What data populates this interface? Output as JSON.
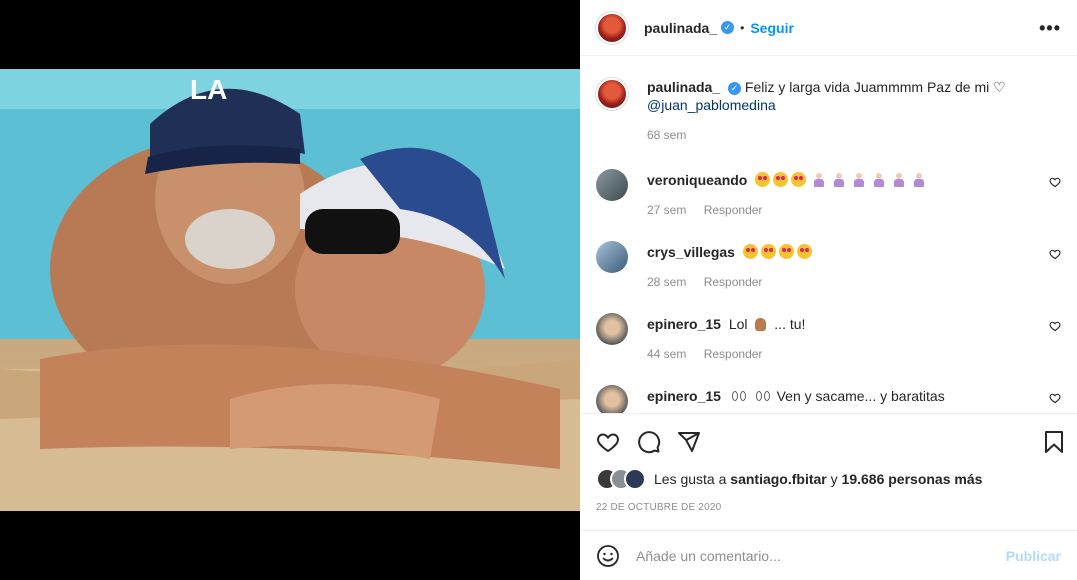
{
  "header": {
    "username": "paulinada_",
    "dot": "•",
    "follow_label": "Seguir",
    "more_label": "•••"
  },
  "caption": {
    "username": "paulinada_",
    "text": "Feliz y larga vida Juammmm Paz de mi ♡",
    "mention": "@juan_pablomedina",
    "time": "68 sem"
  },
  "comments": [
    {
      "username": "veroniqueando",
      "text": "",
      "emoji": "heart-eyes x3, person-bowing x6",
      "time": "27 sem",
      "reply_label": "Responder"
    },
    {
      "username": "crys_villegas",
      "text": "",
      "emoji": "heart-eyes x4",
      "time": "28 sem",
      "reply_label": "Responder"
    },
    {
      "username": "epinero_15",
      "text_before": "Lol",
      "text_after": "... tu!",
      "time": "44 sem",
      "reply_label": "Responder"
    },
    {
      "username": "epinero_15",
      "text": "Ven y sacame... y baratitas"
    }
  ],
  "likes": {
    "prefix": "Les gusta a",
    "user": "santiago.fbitar",
    "middle": "y",
    "count": "19.686 personas más"
  },
  "date": "22 DE OCTUBRE DE 2020",
  "add_comment": {
    "placeholder": "Añade un comentario...",
    "post_label": "Publicar"
  },
  "icons": {
    "like": "heart-icon",
    "comment": "comment-icon",
    "share": "share-icon",
    "save": "bookmark-icon",
    "emoji": "smile-icon"
  },
  "colors": {
    "accent": "#0095f6",
    "verified": "#3897f0",
    "muted": "#8e8e8e"
  }
}
